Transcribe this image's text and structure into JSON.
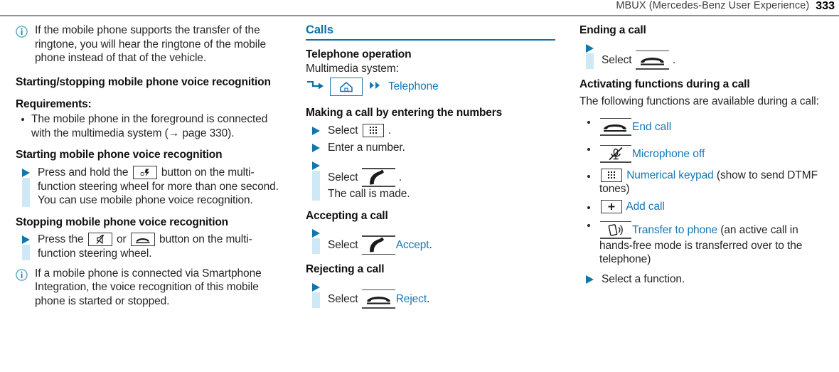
{
  "header": {
    "title": "MBUX (Mercedes-Benz User Experience)",
    "page_number": "333"
  },
  "colors": {
    "accent_blue": "#1577b4",
    "section_blue": "#0d6fa3",
    "step_bar": "#cfe8f5",
    "rule_gray": "#8d9296",
    "text": "#262626"
  },
  "column_left": {
    "note_1": "If the mobile phone supports the transfer of the ringtone, you will hear the ringtone of the mobile phone instead of that of the vehicle.",
    "heading_start_stop": "Starting/stopping mobile phone voice recognition",
    "requirements_label": "Requirements:",
    "requirement_1": "The mobile phone in the foreground is connected with the multimedia system (→ page 330).",
    "heading_starting": "Starting mobile phone voice recognition",
    "step_press_hold_before": "Press and hold the",
    "step_press_hold_after": "button on the multi-function steering wheel for more than one second.",
    "step_press_hold_result": "You can use mobile phone voice recognition.",
    "heading_stopping": "Stopping mobile phone voice recognition",
    "step_press_before": "Press the",
    "step_press_or": "or",
    "step_press_after": "button on the multi-function steering wheel.",
    "note_2": "If a mobile phone is connected via Smartphone Integration, the voice recognition of this mobile phone is started or stopped."
  },
  "column_middle": {
    "section_title": "Calls",
    "heading_telephone_operation": "Telephone operation",
    "multimedia_label": "Multimedia system:",
    "breadcrumb_target": "Telephone",
    "heading_making_call": "Making a call by entering the numbers",
    "step_select_keypad_label": "Select",
    "step_select_keypad_trail": ".",
    "step_enter_number": "Enter a number.",
    "step_select_call_label": "Select",
    "step_select_call_trail": ".",
    "step_call_is_made": "The call is made.",
    "heading_accepting": "Accepting a call",
    "step_accept_label": "Select",
    "step_accept_link": "Accept",
    "step_accept_trail": ".",
    "heading_rejecting": "Rejecting a call",
    "step_reject_label": "Select",
    "step_reject_link": "Reject",
    "step_reject_trail": "."
  },
  "column_right": {
    "heading_ending": "Ending a call",
    "step_end_label": "Select",
    "step_end_trail": ".",
    "heading_activating": "Activating functions during a call",
    "intro": "The following functions are available during a call:",
    "function_end_call": "End call",
    "function_microphone_off": "Microphone off",
    "function_numerical_keypad": "Numerical keypad",
    "function_numerical_keypad_note": "(show to send DTMF tones)",
    "function_add_call": "Add call",
    "function_transfer_to_phone": "Transfer to phone",
    "function_transfer_note": "(an active call in hands-free mode is transferred over to the telephone)",
    "step_select_function": "Select a function."
  },
  "icons": {
    "info": "info-circle-icon",
    "voice_button": "voice-recognition-button-icon",
    "mute_button": "microphone-mute-button-icon",
    "hangup_button": "hangup-phone-button-icon",
    "home": "home-icon",
    "chevrons": "double-chevron-right-icon",
    "arrow_path": "turn-arrow-icon",
    "keypad": "numeric-keypad-icon",
    "call": "phone-receiver-call-icon",
    "end_call": "phone-receiver-hangup-icon",
    "microphone_off": "microphone-off-icon",
    "add_call": "plus-icon",
    "transfer": "transfer-to-phone-icon"
  }
}
